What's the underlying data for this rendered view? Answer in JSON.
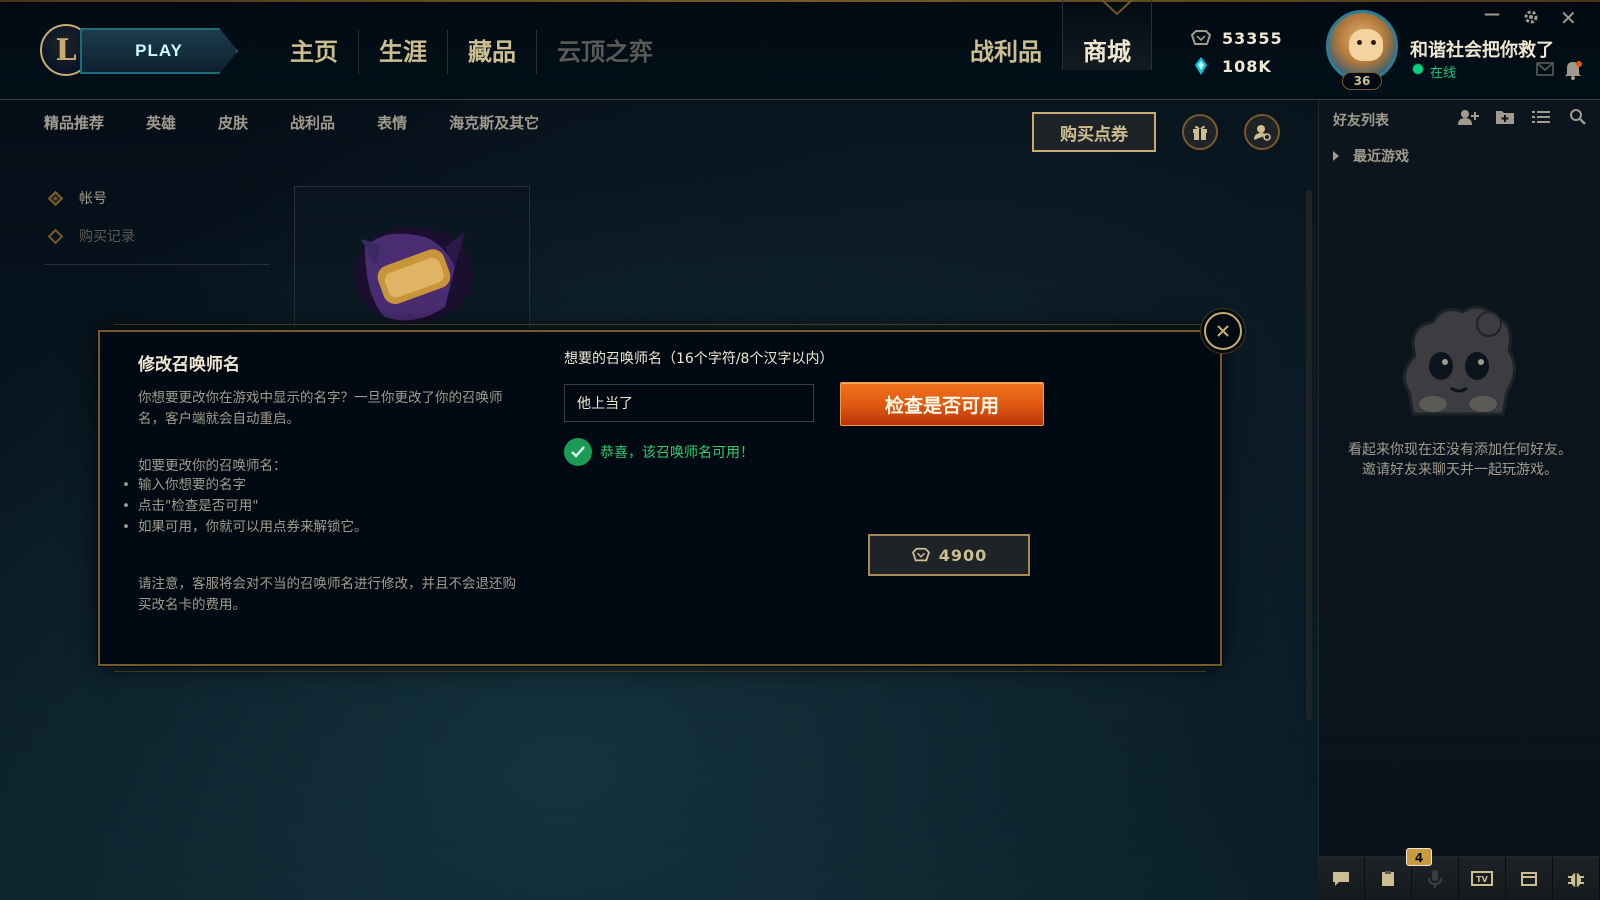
{
  "app": {
    "play_label": "PLAY",
    "logo_letter": "L"
  },
  "nav": {
    "main": [
      "主页",
      "生涯",
      "藏品",
      "云顶之弈"
    ],
    "right": [
      "战利品",
      "商城"
    ],
    "active": "商城"
  },
  "currency": {
    "rp": "53355",
    "be": "108K"
  },
  "profile": {
    "name": "和谐社会把你救了",
    "status": "在线",
    "level": "36"
  },
  "subnav": {
    "items": [
      "精品推荐",
      "英雄",
      "皮肤",
      "战利品",
      "表情",
      "海克斯及其它"
    ],
    "buy_rp_label": "购买点券"
  },
  "sidebar": {
    "items": [
      "帐号",
      "购买记录"
    ]
  },
  "modal": {
    "title": "修改召唤师名",
    "description": "你想要更改你在游戏中显示的名字？一旦你更改了你的召唤师名，客户端就会自动重启。",
    "steps_heading": "如要更改你的召唤师名：",
    "steps": [
      "输入你想要的名字",
      "点击\"检查是否可用\"",
      "如果可用，你就可以用点券来解锁它。"
    ],
    "notice": "请注意，客服将会对不当的召唤师名进行修改，并且不会退还购买改名卡的费用。",
    "field_label": "想要的召唤师名（16个字符/8个汉字以内）",
    "input_value": "他上当了",
    "check_label": "检查是否可用",
    "available_text": "恭喜，该召唤师名可用！",
    "price": "4900"
  },
  "friends": {
    "title": "好友列表",
    "recent_label": "最近游戏",
    "empty_text": "看起来你现在还没有添加任何好友。邀请好友来聊天并一起玩游戏。",
    "notification_count": "4"
  },
  "colors": {
    "gold": "#c8aa6e",
    "gold_dark": "#785a28",
    "bg": "#010a13",
    "accent_orange": "#e05a10",
    "success_green": "#2fcc72",
    "online": "#0acf83"
  }
}
